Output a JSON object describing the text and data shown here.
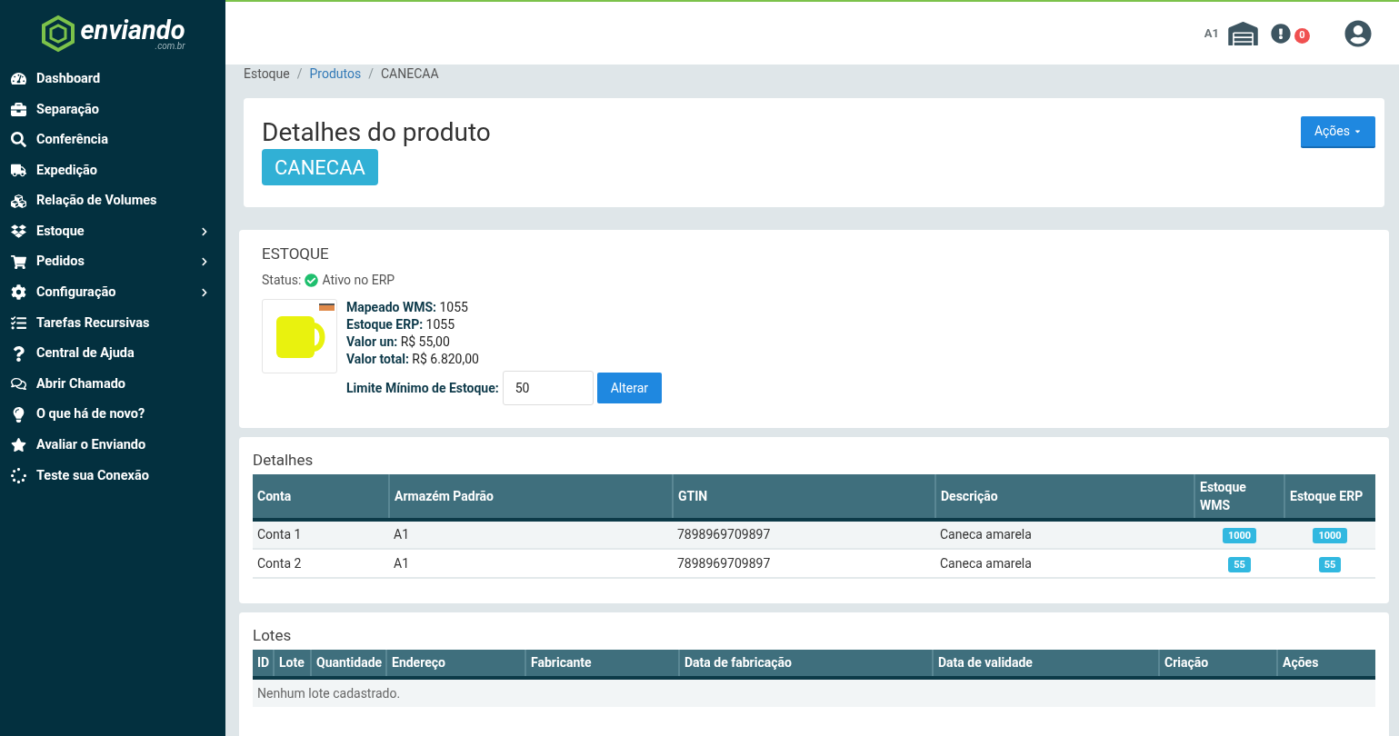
{
  "brand": {
    "name": "enviando",
    "domain": ".com.br"
  },
  "sidebar": {
    "items": [
      {
        "label": "Dashboard",
        "submenu": false
      },
      {
        "label": "Separação",
        "submenu": false
      },
      {
        "label": "Conferência",
        "submenu": false
      },
      {
        "label": "Expedição",
        "submenu": false
      },
      {
        "label": "Relação de Volumes",
        "submenu": false
      },
      {
        "label": "Estoque",
        "submenu": true
      },
      {
        "label": "Pedidos",
        "submenu": true
      },
      {
        "label": "Configuração",
        "submenu": true
      },
      {
        "label": "Tarefas Recursivas",
        "submenu": false
      },
      {
        "label": "Central de Ajuda",
        "submenu": false
      },
      {
        "label": "Abrir Chamado",
        "submenu": false
      },
      {
        "label": "O que há de novo?",
        "submenu": false
      },
      {
        "label": "Avaliar o Enviando",
        "submenu": false
      },
      {
        "label": "Teste sua Conexão",
        "submenu": false
      }
    ]
  },
  "header": {
    "warehouse": "A1",
    "alerts": "0"
  },
  "breadcrumb_separator": "/",
  "breadcrumb": [
    {
      "label": "Estoque",
      "link": false
    },
    {
      "label": "Produtos",
      "link": true
    },
    {
      "label": "CANECAA",
      "link": false
    }
  ],
  "product_header": {
    "title": "Detalhes do produto",
    "sku": "CANECAA",
    "actions_button": "Ações"
  },
  "stock": {
    "title": "ESTOQUE",
    "status_label": "Status:",
    "status": "Ativo no ERP",
    "facts": [
      {
        "label": "Mapeado WMS:",
        "value": "1055"
      },
      {
        "label": "Estoque ERP:",
        "value": "1055"
      },
      {
        "label": "Valor un:",
        "value": "R$ 55,00"
      },
      {
        "label": "Valor total:",
        "value": "R$ 6.820,00"
      }
    ],
    "min_label": "Limite Mínimo de Estoque:",
    "min_value": "50",
    "button": "Alterar"
  },
  "details": {
    "title": "Detalhes",
    "columns": [
      "Conta",
      "Armazém Padrão",
      "GTIN",
      "Descrição",
      "Estoque WMS",
      "Estoque ERP"
    ],
    "rows": [
      [
        "Conta 1",
        "A1",
        "7898969709897",
        "Caneca amarela",
        "1000",
        "1000"
      ],
      [
        "Conta 2",
        "A1",
        "7898969709897",
        "Caneca amarela",
        "55",
        "55"
      ]
    ]
  },
  "lots": {
    "title": "Lotes",
    "columns": [
      "ID",
      "Lote",
      "Quantidade",
      "Endereço",
      "Fabricante",
      "Data de fabricação",
      "Data de validade",
      "Criação",
      "Ações"
    ],
    "empty": "Nenhum lote cadastrado."
  }
}
